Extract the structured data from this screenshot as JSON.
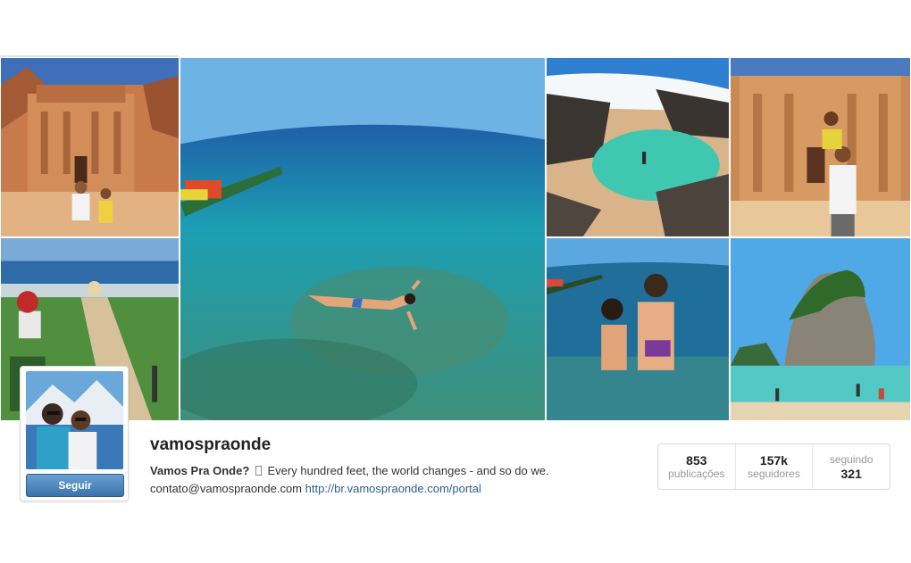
{
  "profile": {
    "username": "vamospraonde",
    "display_name": "Vamos Pra Onde?",
    "bio_text": "Every hundred feet, the world changes - and so do we.",
    "email": "contato@vamospraonde.com",
    "website": "http://br.vamospraonde.com/portal",
    "follow_label": "Seguir"
  },
  "stats": {
    "posts_count": "853",
    "posts_label": "publicações",
    "followers_count": "157k",
    "followers_label": "seguidores",
    "following_label": "seguindo",
    "following_count": "321"
  },
  "colors": {
    "follow_button": "#3a74ad",
    "link": "#2e5e8c"
  }
}
